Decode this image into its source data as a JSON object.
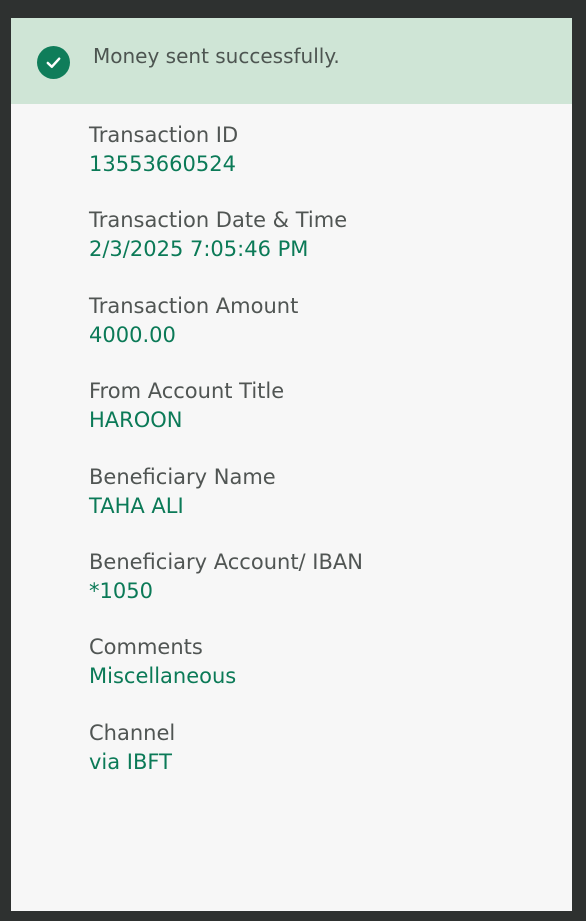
{
  "banner": {
    "icon": "check-circle-icon",
    "message": "Money sent successfully.",
    "accent": "#0f7d5a"
  },
  "details": [
    {
      "label": "Transaction ID",
      "value": "13553660524"
    },
    {
      "label": "Transaction Date & Time",
      "value": "2/3/2025 7:05:46 PM"
    },
    {
      "label": "Transaction Amount",
      "value": "4000.00"
    },
    {
      "label": "From Account Title",
      "value": "HAROON"
    },
    {
      "label": "Beneficiary Name",
      "value": "TAHA ALI"
    },
    {
      "label": "Beneficiary Account/ IBAN",
      "value": "*1050"
    },
    {
      "label": "Comments",
      "value": "Miscellaneous"
    },
    {
      "label": "Channel",
      "value": "via IBFT"
    }
  ]
}
